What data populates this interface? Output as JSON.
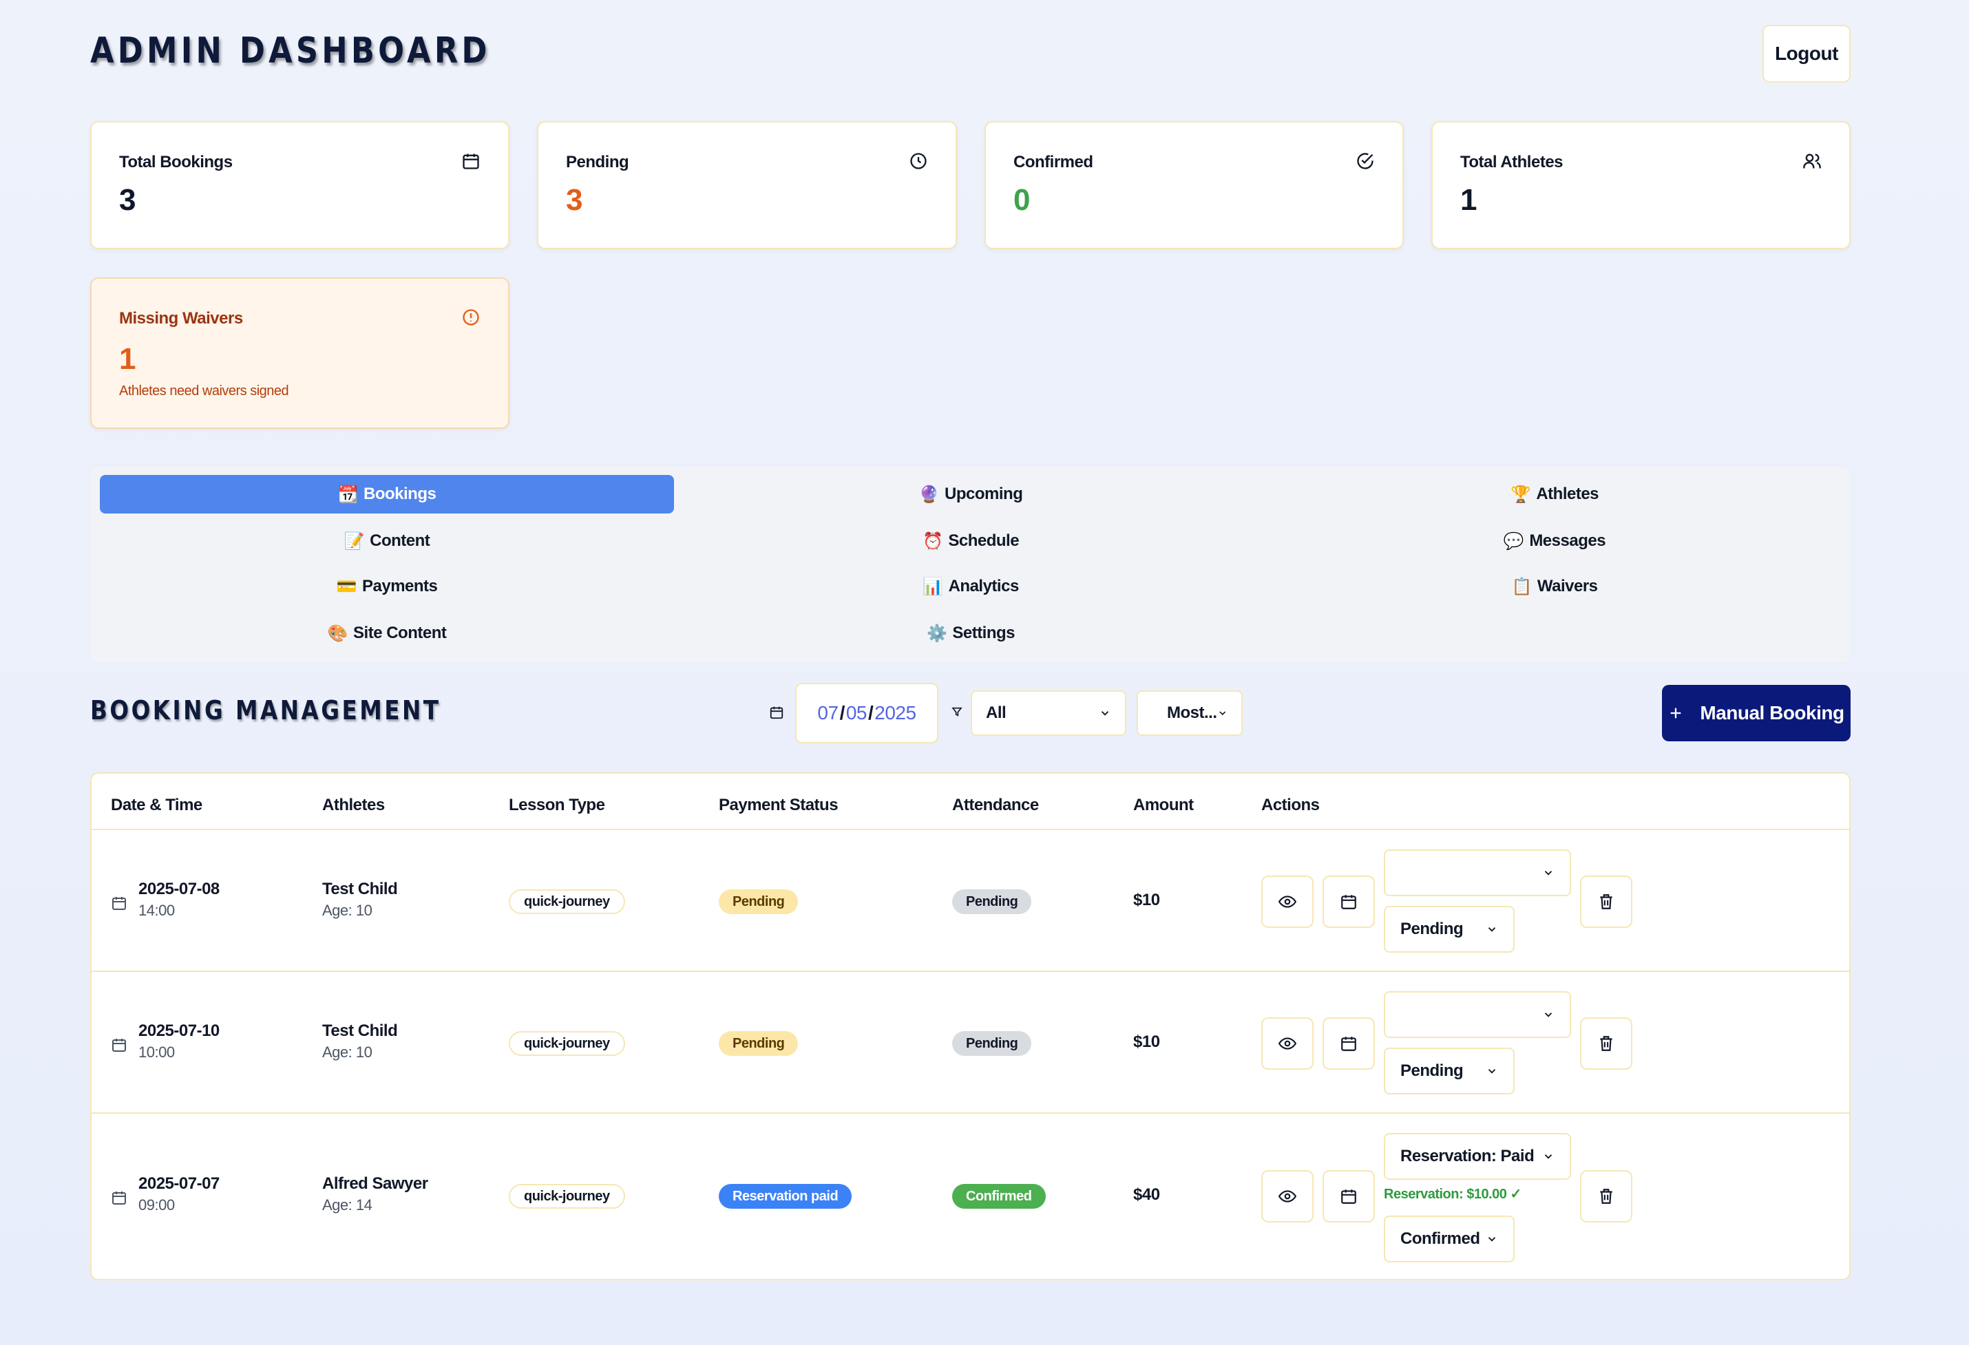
{
  "header": {
    "title": "ADMIN DASHBOARD",
    "logout_label": "Logout"
  },
  "stats": [
    {
      "label": "Total Bookings",
      "value": "3",
      "icon": "calendar-icon",
      "color": "#0f172a"
    },
    {
      "label": "Pending",
      "value": "3",
      "icon": "clock-icon",
      "color": "#e35d18"
    },
    {
      "label": "Confirmed",
      "value": "0",
      "icon": "check-circle-icon",
      "color": "#3fa24a"
    },
    {
      "label": "Total Athletes",
      "value": "1",
      "icon": "users-icon",
      "color": "#0f172a"
    }
  ],
  "missing_waivers": {
    "label": "Missing Waivers",
    "value": "1",
    "sub": "Athletes need waivers signed",
    "icon": "alert-circle-icon"
  },
  "tabs": [
    {
      "emoji": "📆",
      "label": "Bookings",
      "active": true
    },
    {
      "emoji": "🔮",
      "label": "Upcoming"
    },
    {
      "emoji": "🏆",
      "label": "Athletes"
    },
    {
      "emoji": "📝",
      "label": "Content"
    },
    {
      "emoji": "⏰",
      "label": "Schedule"
    },
    {
      "emoji": "💬",
      "label": "Messages"
    },
    {
      "emoji": "💳",
      "label": "Payments"
    },
    {
      "emoji": "📊",
      "label": "Analytics"
    },
    {
      "emoji": "📋",
      "label": "Waivers"
    },
    {
      "emoji": "🎨",
      "label": "Site Content"
    },
    {
      "emoji": "⚙️",
      "label": "Settings"
    }
  ],
  "bookings": {
    "title": "BOOKING MANAGEMENT",
    "date": {
      "month": "07",
      "day": "05",
      "year": "2025"
    },
    "filter_value": "All",
    "sort_value": "Most...",
    "manual_button": "Manual Booking",
    "columns": [
      "Date & Time",
      "Athletes",
      "Lesson Type",
      "Payment Status",
      "Attendance",
      "Amount",
      "Actions"
    ],
    "rows": [
      {
        "date": "2025-07-08",
        "time": "14:00",
        "athlete": "Test Child",
        "age": "Age: 10",
        "lesson": "quick-journey",
        "payment": "Pending",
        "attendance": "Pending",
        "amount": "$10",
        "payment_select": "",
        "attendance_select": "Pending",
        "note": ""
      },
      {
        "date": "2025-07-10",
        "time": "10:00",
        "athlete": "Test Child",
        "age": "Age: 10",
        "lesson": "quick-journey",
        "payment": "Pending",
        "attendance": "Pending",
        "amount": "$10",
        "payment_select": "",
        "attendance_select": "Pending",
        "note": ""
      },
      {
        "date": "2025-07-07",
        "time": "09:00",
        "athlete": "Alfred Sawyer",
        "age": "Age: 14",
        "lesson": "quick-journey",
        "payment": "Reservation paid",
        "attendance": "Confirmed",
        "amount": "$40",
        "payment_select": "Reservation: Paid",
        "attendance_select": "Confirmed",
        "note": "Reservation: $10.00 ✓"
      }
    ]
  }
}
